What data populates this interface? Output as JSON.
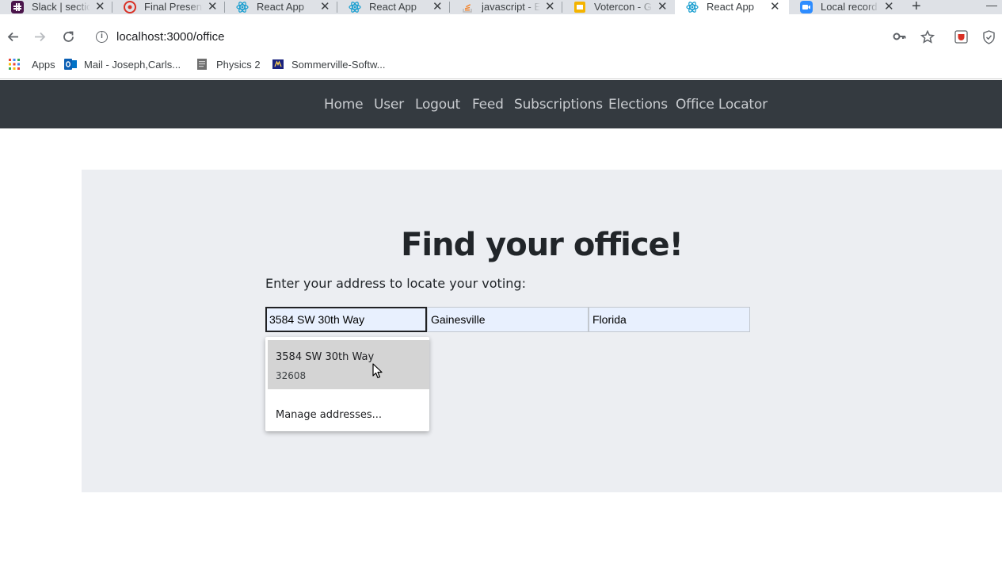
{
  "browser": {
    "tabs": [
      {
        "title": "Slack | sectio",
        "icon": "slack-icon",
        "color": "#4a154b"
      },
      {
        "title": "Final Present",
        "icon": "presentation-icon",
        "color": "#e44d26"
      },
      {
        "title": "React App",
        "icon": "react-icon",
        "color": "#61dafb"
      },
      {
        "title": "React App",
        "icon": "react-icon",
        "color": "#61dafb"
      },
      {
        "title": "javascript - E",
        "icon": "stackoverflow-icon",
        "color": "#f48024"
      },
      {
        "title": "Votercon - G",
        "icon": "slides-icon",
        "color": "#f4b400"
      },
      {
        "title": "React App",
        "icon": "react-icon",
        "color": "#61dafb",
        "active": true
      },
      {
        "title": "Local record",
        "icon": "zoom-icon",
        "color": "#2d8cff"
      }
    ],
    "url": "localhost:3000/office",
    "bookmarks": [
      {
        "label": "Apps",
        "icon": "apps-grid-icon"
      },
      {
        "label": "Mail - Joseph,Carls...",
        "icon": "outlook-icon"
      },
      {
        "label": "Physics 2",
        "icon": "page-icon"
      },
      {
        "label": "Sommerville-Softw...",
        "icon": "book-icon"
      }
    ]
  },
  "nav": {
    "links": [
      "Home",
      "User",
      "Logout",
      "Feed",
      "Subscriptions",
      "Elections",
      "Office Locator"
    ]
  },
  "page": {
    "heading": "Find your office!",
    "subtext": "Enter your address to locate your voting:",
    "fields": {
      "street": "3584 SW 30th Way",
      "city": "Gainesville",
      "state": "Florida"
    },
    "autocomplete": {
      "title": "3584 SW 30th Way",
      "subtitle": "32608",
      "manage": "Manage addresses..."
    }
  },
  "colors": {
    "navbar": "#343a40",
    "panel": "#eceef2",
    "autofill": "#e8f0fe"
  }
}
